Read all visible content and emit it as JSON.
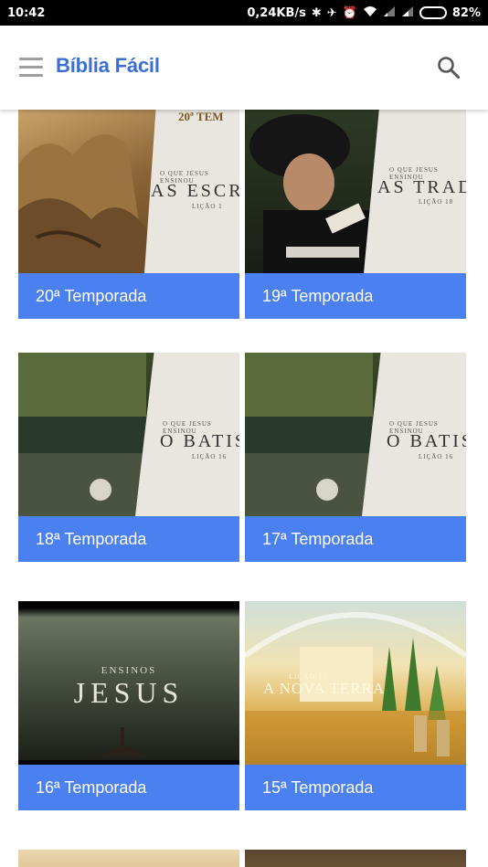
{
  "status_bar": {
    "time": "10:42",
    "network_speed": "0,24KB/s",
    "battery_percent": "82%",
    "battery_level": 0.82,
    "icons": [
      "bluetooth-icon",
      "mute-icon",
      "alarm-icon",
      "wifi-icon",
      "signal-icon",
      "signal-icon",
      "battery-icon"
    ]
  },
  "app_bar": {
    "title": "Bíblia Fácil",
    "menu_icon": "menu-icon",
    "search_icon": "search-icon"
  },
  "cards": [
    {
      "label": "20ª Temporada",
      "thumb": {
        "small": "O QUE JESUS ENSINOU",
        "big": "AS ESCRITU",
        "lesson": "LIÇÃO 1",
        "banner": "20ª TEM"
      }
    },
    {
      "label": "19ª Temporada",
      "thumb": {
        "small": "O QUE JESUS ENSINOU",
        "big": "AS TRADIÇ",
        "lesson": "LIÇÃO 18"
      }
    },
    {
      "label": "18ª Temporada",
      "thumb": {
        "small": "O QUE JESUS ENSINOU",
        "big": "O BATIS",
        "lesson": "LIÇÃO 16"
      }
    },
    {
      "label": "17ª Temporada",
      "thumb": {
        "small": "O QUE JESUS ENSINOU",
        "big": "O BATIS",
        "lesson": "LIÇÃO 16"
      }
    },
    {
      "label": "16ª Temporada",
      "thumb": {
        "small": "ENSINOS",
        "big": "JESUS"
      }
    },
    {
      "label": "15ª Temporada",
      "thumb": {
        "small": "LIÇÃO 13",
        "big": "A NOVA TERRA"
      }
    }
  ],
  "colors": {
    "accent": "#3b6fd6",
    "card_label_bg": "#4a80f0",
    "status_bar_bg": "#000000"
  }
}
